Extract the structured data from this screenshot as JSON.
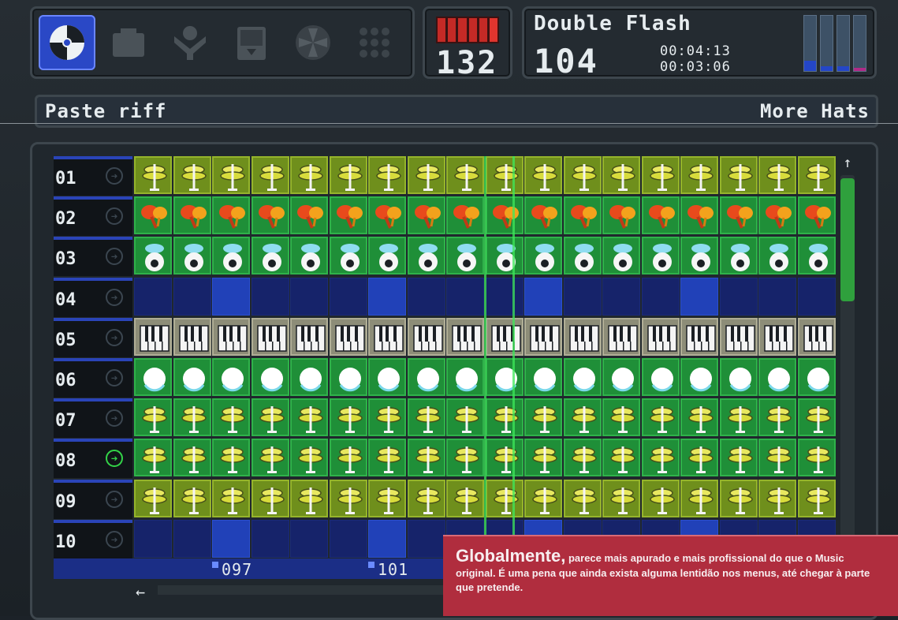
{
  "toolbar": {
    "tools": [
      {
        "name": "disc-icon",
        "active": true
      },
      {
        "name": "tv-icon",
        "active": false
      },
      {
        "name": "mixer-icon",
        "active": false
      },
      {
        "name": "drive-icon",
        "active": false
      },
      {
        "name": "fan-icon",
        "active": false
      },
      {
        "name": "grid-icon",
        "active": false
      }
    ]
  },
  "bpm": {
    "value": "132"
  },
  "song": {
    "title": "Double Flash",
    "pattern": "104",
    "time_total": "00:04:13",
    "time_elapsed": "00:03:06",
    "levels": [
      0.18,
      0.08,
      0.08,
      0.06
    ]
  },
  "status": {
    "left": "Paste riff",
    "right": "More Hats"
  },
  "tracks": [
    {
      "num": "01",
      "icon": "hihat-icon",
      "style": "lime",
      "selected": false
    },
    {
      "num": "02",
      "icon": "maracas-icon",
      "style": "green",
      "selected": false
    },
    {
      "num": "03",
      "icon": "pad-icon",
      "style": "green",
      "selected": false
    },
    {
      "num": "04",
      "icon": "",
      "style": "empty",
      "selected": false
    },
    {
      "num": "05",
      "icon": "keys-icon",
      "style": "gray",
      "selected": false
    },
    {
      "num": "06",
      "icon": "bass-icon",
      "style": "green",
      "selected": false
    },
    {
      "num": "07",
      "icon": "hihat-icon",
      "style": "green",
      "selected": false
    },
    {
      "num": "08",
      "icon": "hihat-icon",
      "style": "green",
      "selected": true
    },
    {
      "num": "09",
      "icon": "hihat-icon",
      "style": "lime",
      "selected": false
    },
    {
      "num": "10",
      "icon": "",
      "style": "empty",
      "selected": false
    }
  ],
  "steps_per_track": 18,
  "markers": [
    {
      "label": "097",
      "step": 2
    },
    {
      "label": "101",
      "step": 6
    }
  ],
  "caption": {
    "lead": "Globalmente,",
    "body": " parece mais apurado e mais profissional do que o Music original. É uma pena que ainda exista alguma lentidão nos menus, até chegar à parte que pretende."
  },
  "colors": {
    "accent": "#2a48c6",
    "playhead": "#3ee85a",
    "caption_bg": "#b02d3e"
  }
}
